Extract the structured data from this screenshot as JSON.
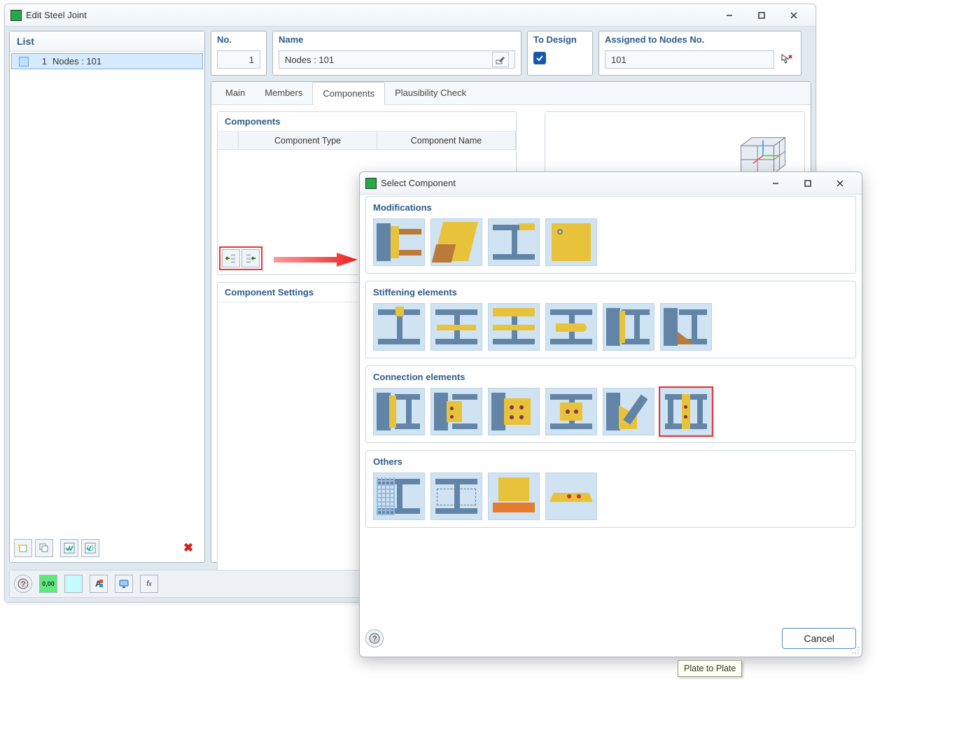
{
  "mainWindow": {
    "title": "Edit Steel Joint",
    "listHeader": "List",
    "listItemNum": "1",
    "listItemText": "Nodes : 101",
    "noLabel": "No.",
    "noValue": "1",
    "nameLabel": "Name",
    "nameValue": "Nodes : 101",
    "toDesignLabel": "To Design",
    "assignedLabel": "Assigned to Nodes No.",
    "assignedValue": "101",
    "tabs": {
      "main": "Main",
      "members": "Members",
      "components": "Components",
      "plaus": "Plausibility Check"
    },
    "componentsHeader": "Components",
    "colType": "Component Type",
    "colName": "Component Name",
    "settingsHeader": "Component Settings"
  },
  "selectDialog": {
    "title": "Select Component",
    "cat1": "Modifications",
    "cat2": "Stiffening elements",
    "cat3": "Connection elements",
    "cat4": "Others",
    "tooltip": "Plate to Plate",
    "cancel": "Cancel"
  }
}
